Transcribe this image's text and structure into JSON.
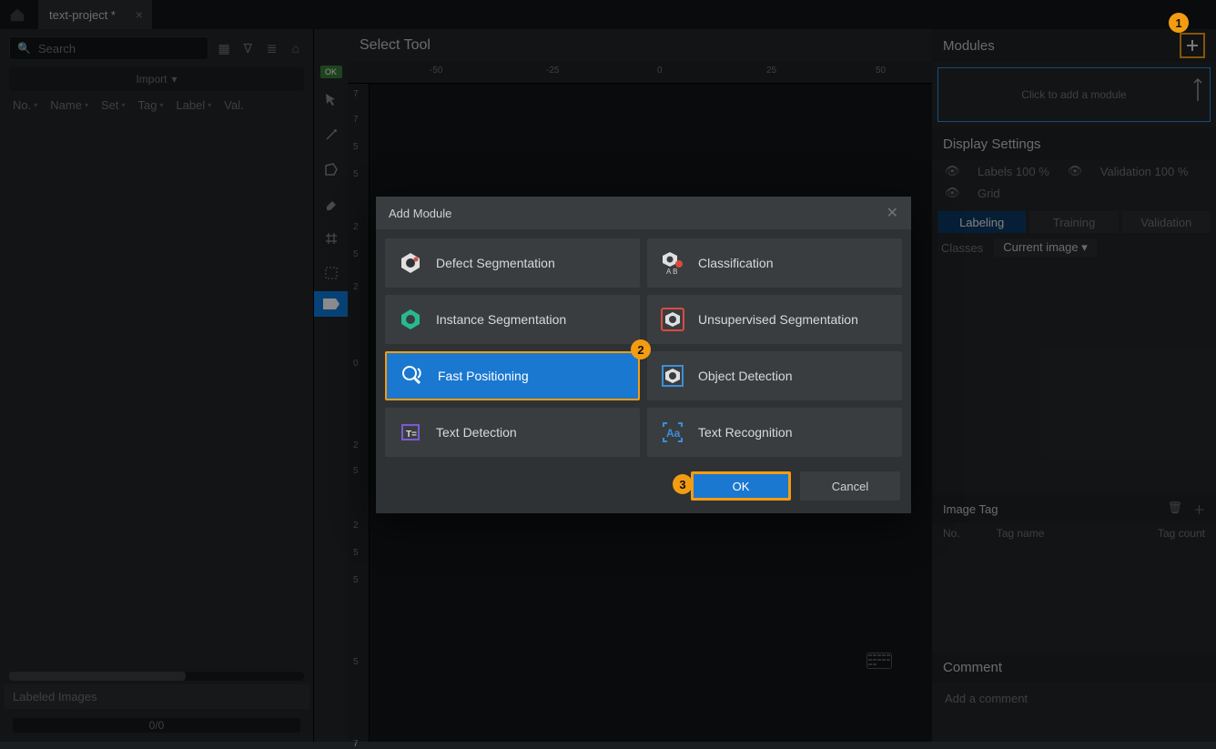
{
  "titlebar": {
    "tab": "text-project *"
  },
  "left": {
    "search_placeholder": "Search",
    "import": "Import",
    "columns": [
      "No.",
      "Name",
      "Set",
      "Tag",
      "Label",
      "Val."
    ],
    "labeled_images": "Labeled Images",
    "progress": "0/0"
  },
  "center": {
    "select_tool": "Select Tool",
    "ok_badge": "OK",
    "ruler_h": [
      {
        "pos": 90,
        "label": "-50"
      },
      {
        "pos": 218,
        "label": "-25"
      },
      {
        "pos": 340,
        "label": "0"
      },
      {
        "pos": 460,
        "label": "25"
      },
      {
        "pos": 580,
        "label": "50"
      }
    ],
    "ruler_v": [
      {
        "pos": 6,
        "label": "7"
      },
      {
        "pos": 34,
        "label": "7"
      },
      {
        "pos": 64,
        "label": "5"
      },
      {
        "pos": 94,
        "label": "5"
      },
      {
        "pos": 152,
        "label": "2"
      },
      {
        "pos": 182,
        "label": "5"
      },
      {
        "pos": 218,
        "label": "2"
      },
      {
        "pos": 302,
        "label": "0"
      },
      {
        "pos": 392,
        "label": "2"
      },
      {
        "pos": 420,
        "label": "5"
      },
      {
        "pos": 480,
        "label": "2"
      },
      {
        "pos": 510,
        "label": "5"
      },
      {
        "pos": 540,
        "label": "5"
      },
      {
        "pos": 630,
        "label": "5"
      },
      {
        "pos": 720,
        "label": "7"
      }
    ]
  },
  "right": {
    "modules_title": "Modules",
    "module_drop": "Click to add a module",
    "display_settings": "Display Settings",
    "labels": "Labels 100 %",
    "validation": "Validation 100 %",
    "grid": "Grid",
    "tabs": [
      "Labeling",
      "Training",
      "Validation"
    ],
    "classes": "Classes",
    "current_image": "Current image ▾",
    "image_tag": "Image Tag",
    "tag_headers": [
      "No.",
      "Tag name",
      "Tag count"
    ],
    "comment": "Comment",
    "comment_placeholder": "Add a comment"
  },
  "dialog": {
    "title": "Add Module",
    "items": [
      "Defect Segmentation",
      "Classification",
      "Instance Segmentation",
      "Unsupervised Segmentation",
      "Fast Positioning",
      "Object Detection",
      "Text Detection",
      "Text Recognition"
    ],
    "ok": "OK",
    "cancel": "Cancel"
  },
  "badges": {
    "one": "1",
    "two": "2",
    "three": "3"
  }
}
